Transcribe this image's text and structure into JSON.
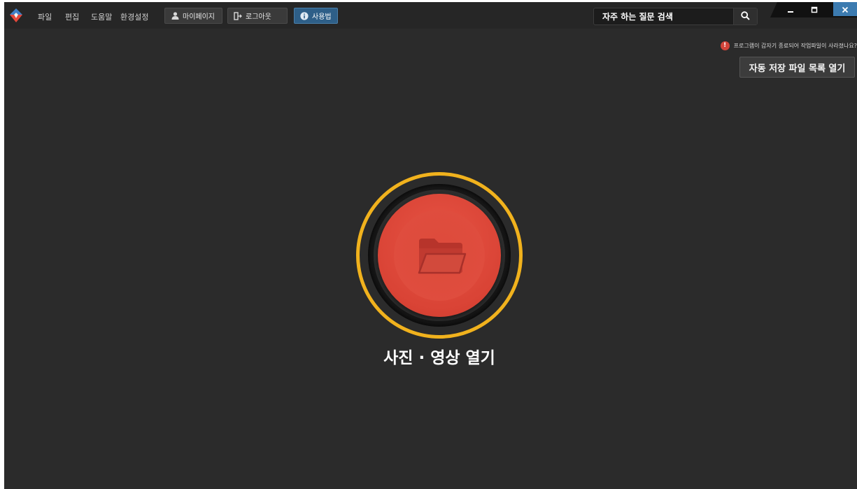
{
  "menu": {
    "items": [
      "파일",
      "편집",
      "도움말",
      "환경설정"
    ]
  },
  "toolbar": {
    "mypage_label": "마이페이지",
    "logout_label": "로그아웃",
    "howto_label": "사용법"
  },
  "search": {
    "placeholder": "자주 하는 질문 검색"
  },
  "notice": {
    "icon_text": "!",
    "text": "프로그램이 갑자기 종료되어 작업파일이 사라졌나요?"
  },
  "autosave": {
    "label": "자동 저장 파일 목록 열기"
  },
  "main": {
    "open_label": "사진 · 영상 열기"
  },
  "colors": {
    "background": "#2b2b2b",
    "accent_red": "#d94335",
    "accent_gold": "#f1b21d",
    "active_blue": "#2e5f88"
  },
  "icons": [
    "app-logo-icon",
    "user-icon",
    "logout-icon",
    "info-icon",
    "search-icon",
    "minimize-icon",
    "maximize-icon",
    "close-icon",
    "alert-icon",
    "folder-icon"
  ]
}
